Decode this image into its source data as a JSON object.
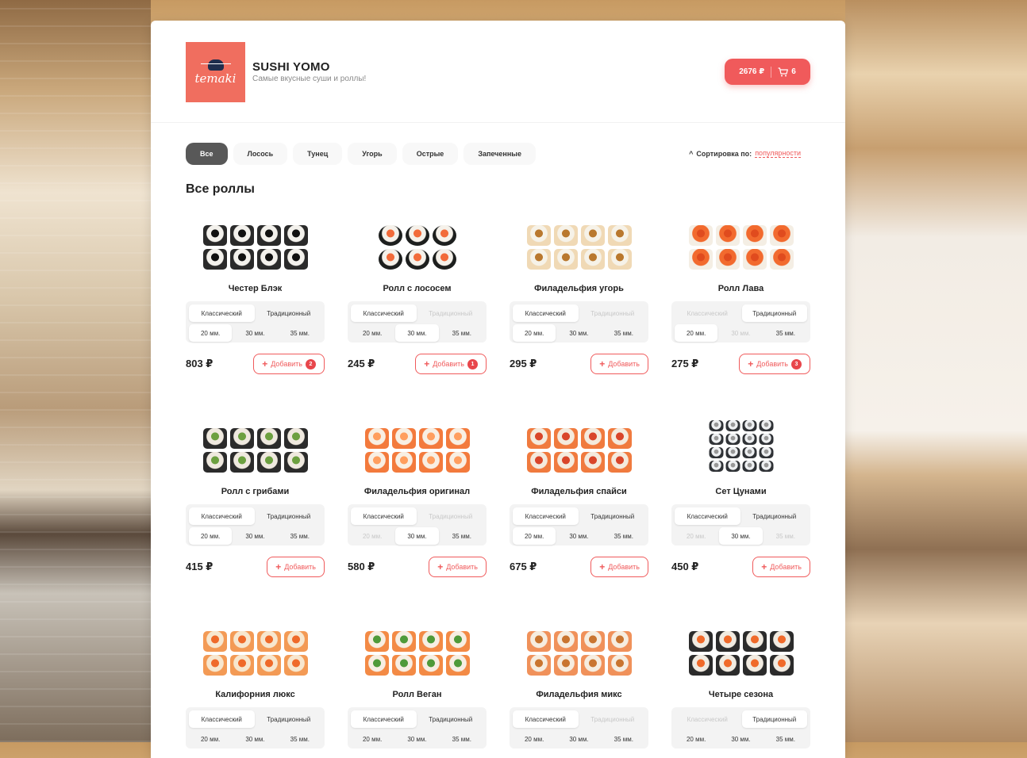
{
  "header": {
    "brand_title": "SUSHI YOMO",
    "brand_subtitle": "Самые вкусные суши и роллы!",
    "logo_text": "temaki",
    "cart": {
      "total": "2676 ₽",
      "count": "6"
    }
  },
  "filters": [
    "Все",
    "Лосось",
    "Тунец",
    "Угорь",
    "Острые",
    "Запеченные"
  ],
  "sort": {
    "label": "Сортировка по:",
    "value": "популярности"
  },
  "section_title": "Все роллы",
  "add_label": "Добавить",
  "variant_labels": [
    "Классический",
    "Традиционный"
  ],
  "size_labels": [
    "20 мм.",
    "30 мм.",
    "35 мм."
  ],
  "products": [
    {
      "name": "Честер Блэк",
      "price": "803 ₽",
      "badge": "2",
      "variant": 0,
      "variant_disabled": [],
      "size": 0,
      "size_disabled": [],
      "style": "black"
    },
    {
      "name": "Ролл с лососем",
      "price": "245 ₽",
      "badge": "1",
      "variant": 0,
      "variant_disabled": [
        1
      ],
      "size": 1,
      "size_disabled": [],
      "style": "salmon-maki"
    },
    {
      "name": "Филадельфия угорь",
      "price": "295 ₽",
      "badge": "",
      "variant": 0,
      "variant_disabled": [
        1
      ],
      "size": 0,
      "size_disabled": [],
      "style": "eel"
    },
    {
      "name": "Ролл Лава",
      "price": "275 ₽",
      "badge": "3",
      "variant": 1,
      "variant_disabled": [
        0
      ],
      "size": 0,
      "size_disabled": [
        1
      ],
      "style": "lava"
    },
    {
      "name": "Ролл с грибами",
      "price": "415 ₽",
      "badge": "",
      "variant": 0,
      "variant_disabled": [],
      "size": 0,
      "size_disabled": [],
      "style": "black-mush"
    },
    {
      "name": "Филадельфия оригинал",
      "price": "580 ₽",
      "badge": "",
      "variant": 0,
      "variant_disabled": [
        1
      ],
      "size": 1,
      "size_disabled": [
        0
      ],
      "style": "phila"
    },
    {
      "name": "Филадельфия спайси",
      "price": "675 ₽",
      "badge": "",
      "variant": 0,
      "variant_disabled": [],
      "size": 0,
      "size_disabled": [],
      "style": "spicy"
    },
    {
      "name": "Сет Цунами",
      "price": "450 ₽",
      "badge": "",
      "variant": 0,
      "variant_disabled": [],
      "size": 1,
      "size_disabled": [
        0,
        2
      ],
      "style": "tsunami"
    },
    {
      "name": "Калифорния люкс",
      "price": "",
      "badge": "",
      "variant": 0,
      "variant_disabled": [],
      "size": -1,
      "size_disabled": [],
      "style": "california"
    },
    {
      "name": "Ролл Веган",
      "price": "",
      "badge": "",
      "variant": 0,
      "variant_disabled": [],
      "size": -1,
      "size_disabled": [],
      "style": "vegan"
    },
    {
      "name": "Филадельфия микс",
      "price": "",
      "badge": "",
      "variant": 0,
      "variant_disabled": [
        1
      ],
      "size": -1,
      "size_disabled": [],
      "style": "mix"
    },
    {
      "name": "Четыре сезона",
      "price": "",
      "badge": "",
      "variant": 1,
      "variant_disabled": [
        0
      ],
      "size": -1,
      "size_disabled": [],
      "style": "seasons"
    }
  ],
  "colors": {
    "accent": "#f05a5b",
    "chip_active": "#585858",
    "logo_bg": "#f06e5f"
  },
  "icons": {
    "cart": "cart-icon",
    "sort": "chevron-up-icon",
    "add": "plus-icon"
  }
}
